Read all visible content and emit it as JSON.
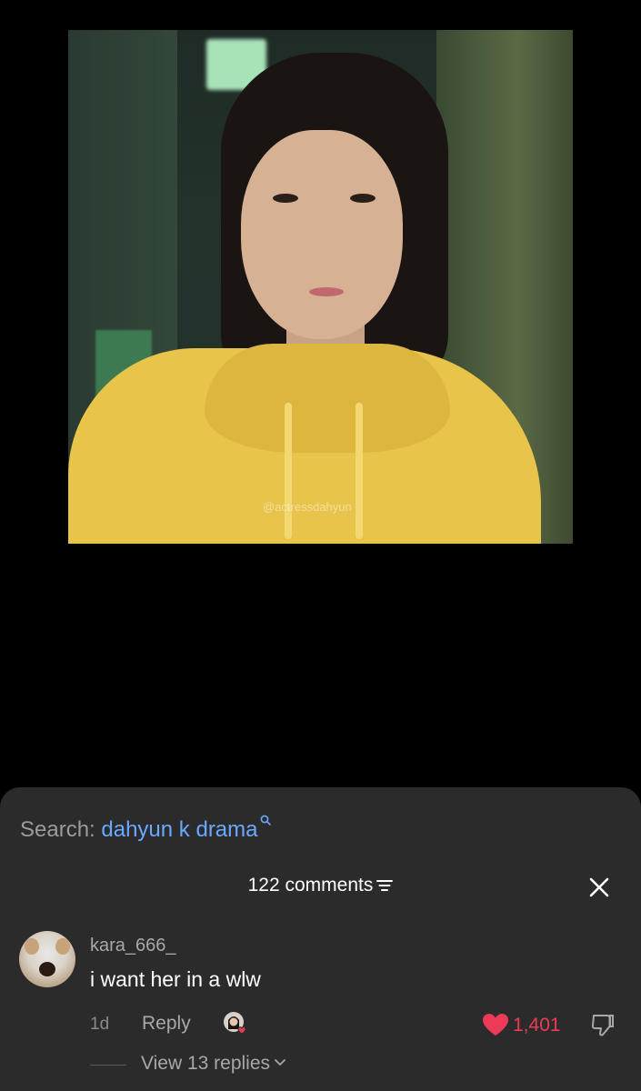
{
  "video": {
    "watermark": "@actressdahyun"
  },
  "search": {
    "label": "Search:",
    "term": "dahyun k drama",
    "icon": "search-icon"
  },
  "comments": {
    "header": "122 comments",
    "sort_icon": "sort-icon",
    "close_icon": "close-icon",
    "items": [
      {
        "username": "kara_666_",
        "text": "i want her in a wlw",
        "time": "1d",
        "reply_label": "Reply",
        "likes": "1,401",
        "view_replies": "View 13 replies"
      }
    ]
  },
  "colors": {
    "accent_link": "#6aa9ff",
    "like_red": "#ec3a57",
    "sheet_bg": "#2b2b2b"
  }
}
